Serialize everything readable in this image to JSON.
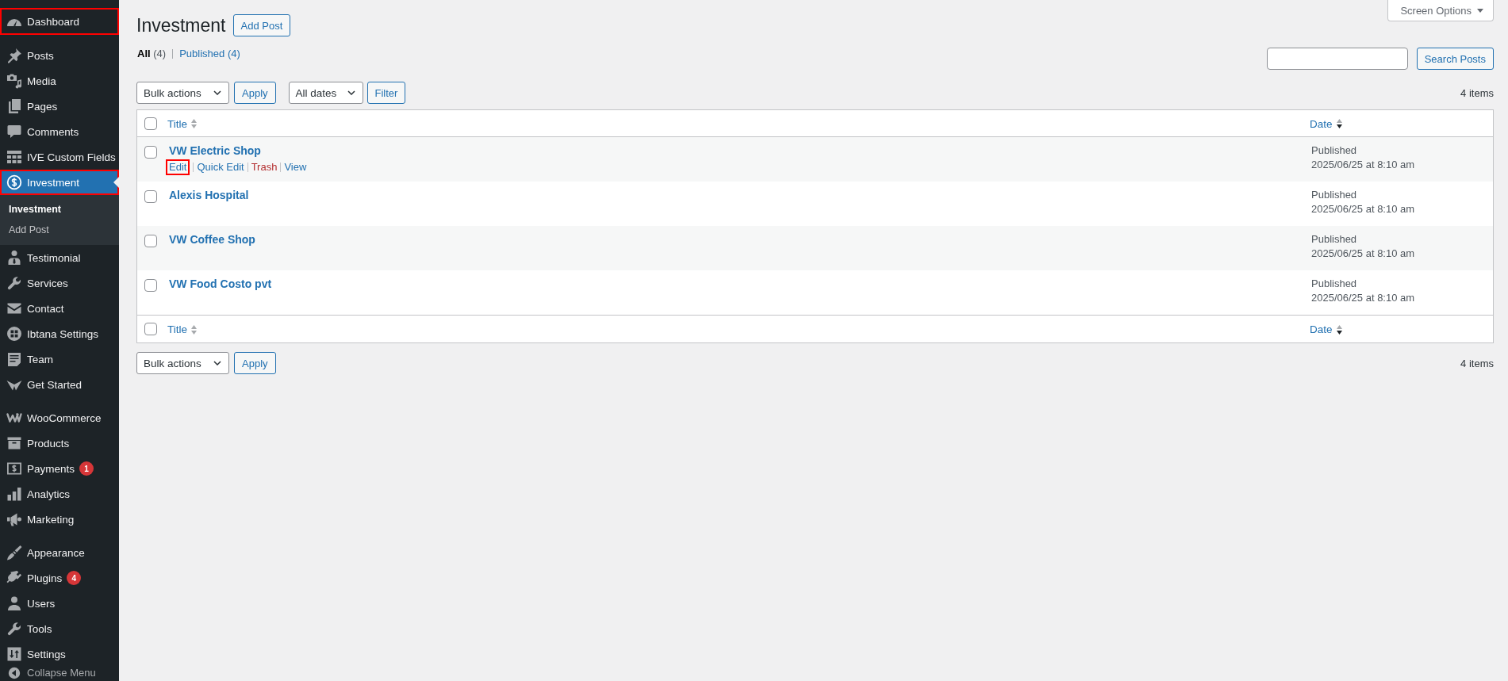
{
  "sidebar": {
    "groups": [
      {
        "items": [
          {
            "label": "Dashboard",
            "selected": false,
            "annotated": true
          }
        ]
      },
      {
        "items": [
          {
            "label": "Posts",
            "selected": false,
            "annotated": false
          },
          {
            "label": "Media",
            "selected": false,
            "annotated": false
          },
          {
            "label": "Pages",
            "selected": false,
            "annotated": false
          },
          {
            "label": "Comments",
            "selected": false,
            "annotated": false
          },
          {
            "label": "IVE Custom Fields",
            "selected": false,
            "annotated": false
          },
          {
            "label": "Investment",
            "selected": true,
            "annotated": true,
            "submenu": [
              {
                "label": "Investment",
                "selected": true
              },
              {
                "label": "Add Post",
                "selected": false
              }
            ]
          },
          {
            "label": "Testimonial",
            "selected": false,
            "annotated": false
          },
          {
            "label": "Services",
            "selected": false,
            "annotated": false
          },
          {
            "label": "Contact",
            "selected": false,
            "annotated": false
          },
          {
            "label": "Ibtana Settings",
            "selected": false,
            "annotated": false
          },
          {
            "label": "Team",
            "selected": false,
            "annotated": false
          },
          {
            "label": "Get Started",
            "selected": false,
            "annotated": false
          }
        ]
      },
      {
        "items": [
          {
            "label": "WooCommerce",
            "selected": false,
            "annotated": false
          },
          {
            "label": "Products",
            "selected": false,
            "annotated": false
          },
          {
            "label": "Payments",
            "selected": false,
            "annotated": false,
            "badge": "1"
          },
          {
            "label": "Analytics",
            "selected": false,
            "annotated": false
          },
          {
            "label": "Marketing",
            "selected": false,
            "annotated": false
          }
        ]
      },
      {
        "items": [
          {
            "label": "Appearance",
            "selected": false,
            "annotated": false
          },
          {
            "label": "Plugins",
            "selected": false,
            "annotated": false,
            "badge": "4"
          },
          {
            "label": "Users",
            "selected": false,
            "annotated": false
          },
          {
            "label": "Tools",
            "selected": false,
            "annotated": false
          },
          {
            "label": "Settings",
            "selected": false,
            "annotated": false
          }
        ]
      }
    ],
    "collapse": {
      "label": "Collapse Menu"
    }
  },
  "header": {
    "title": "Investment",
    "add_button": "Add Post",
    "screen_options": "Screen Options"
  },
  "views": [
    {
      "label": "All",
      "count": "(4)",
      "selected": true
    },
    {
      "label": "Published",
      "count": "(4)",
      "selected": false
    }
  ],
  "search": {
    "button": "Search Posts"
  },
  "tablenav_top": {
    "bulk_actions": "Bulk actions",
    "apply": "Apply",
    "dates": "All dates",
    "filter": "Filter",
    "count": "4 items"
  },
  "table": {
    "header": {
      "checked": false,
      "columns": [
        {
          "label": "Title",
          "sorted": false
        },
        {
          "label": "Date",
          "sorted": true
        }
      ]
    },
    "rows": [
      {
        "title": "VW Electric Shop",
        "checked": false,
        "status": "Published",
        "date": "2025/06/25 at 8:10 am",
        "actions": [
          {
            "label": "Edit",
            "kind": "link",
            "annotated": true
          },
          {
            "label": "Quick Edit",
            "kind": "link",
            "annotated": false
          },
          {
            "label": "Trash",
            "kind": "danger",
            "annotated": false
          },
          {
            "label": "View",
            "kind": "link",
            "annotated": false
          }
        ]
      },
      {
        "title": "Alexis Hospital",
        "checked": false,
        "status": "Published",
        "date": "2025/06/25 at 8:10 am"
      },
      {
        "title": "VW Coffee Shop",
        "checked": false,
        "status": "Published",
        "date": "2025/06/25 at 8:10 am"
      },
      {
        "title": "VW Food Costo pvt",
        "checked": false,
        "status": "Published",
        "date": "2025/06/25 at 8:10 am"
      }
    ],
    "footer": {
      "checked": false,
      "columns": [
        {
          "label": "Title",
          "sorted": false
        },
        {
          "label": "Date",
          "sorted": true
        }
      ]
    }
  },
  "tablenav_bottom": {
    "bulk_actions": "Bulk actions",
    "apply": "Apply",
    "count": "4 items"
  }
}
